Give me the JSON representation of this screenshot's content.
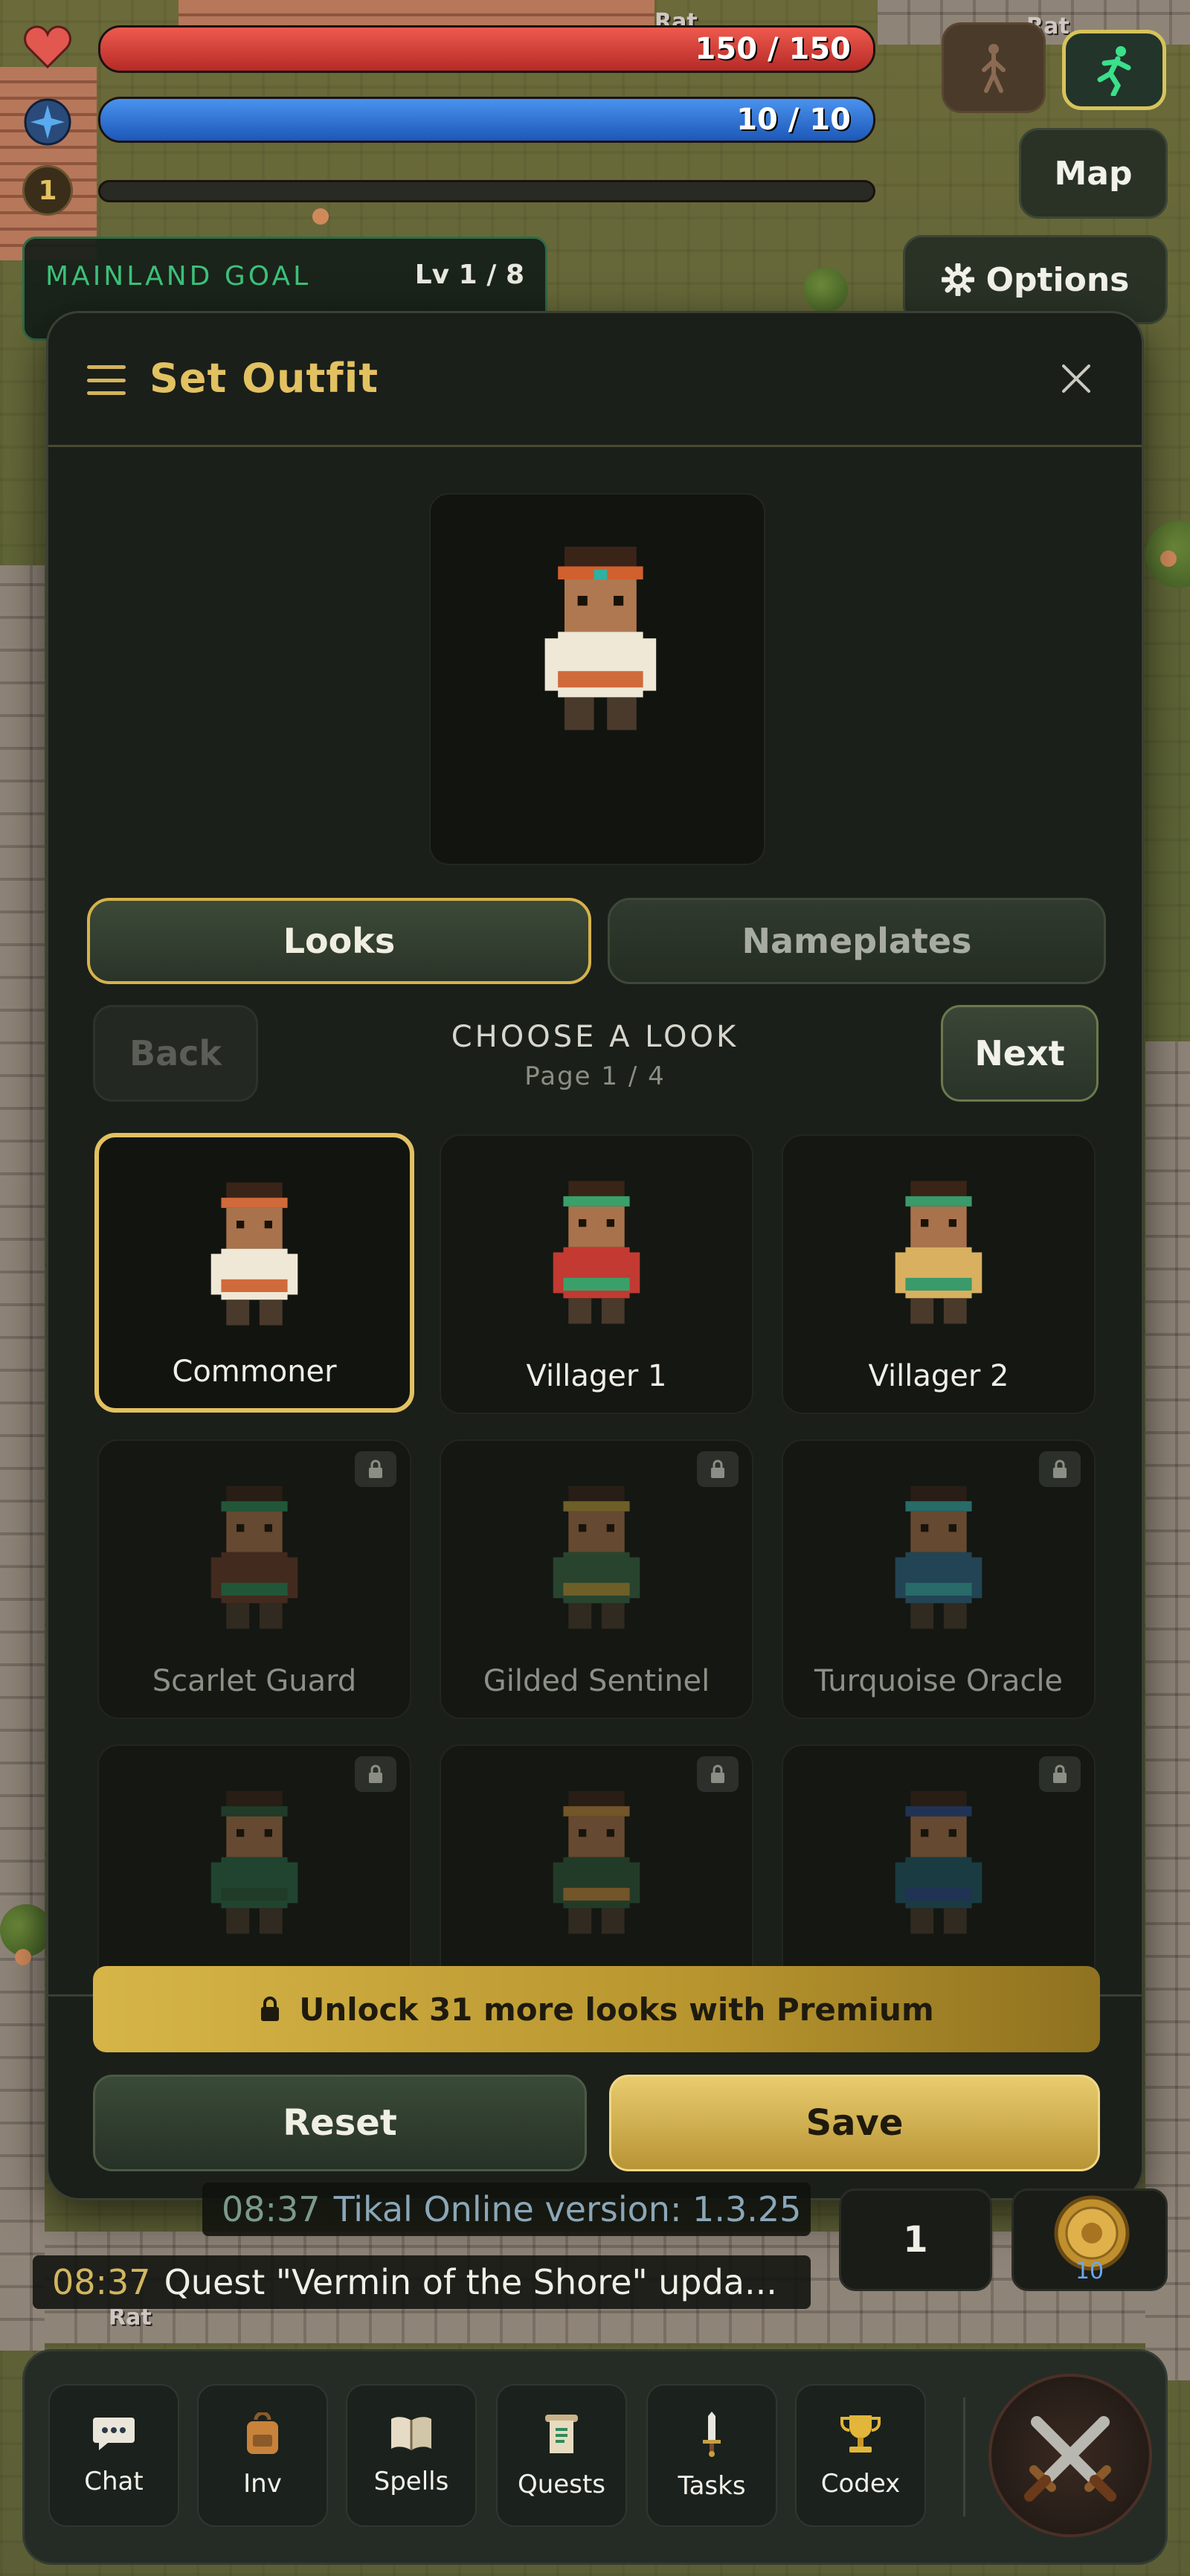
{
  "hud": {
    "health_text": "150 / 150",
    "health_fraction": 1.0,
    "mana_text": "10 / 10",
    "mana_fraction": 1.0,
    "level": "1",
    "xp_fraction": 0.0,
    "map_label": "Map",
    "options_label": "Options",
    "goal_label": "MAINLAND GOAL",
    "goal_level": "Lv 1 / 8",
    "colors": {
      "health": "#d43a3a",
      "mana": "#2f74d8",
      "accent_gold": "#e2c161"
    }
  },
  "world_labels": [
    "Rat",
    "Rat",
    "Rat"
  ],
  "modal": {
    "title": "Set Outfit",
    "tabs": [
      {
        "label": "Looks",
        "active": true
      },
      {
        "label": "Nameplates",
        "active": false
      }
    ],
    "back_label": "Back",
    "next_label": "Next",
    "choose_label": "CHOOSE A LOOK",
    "page_label": "Page 1 / 4",
    "looks": [
      {
        "name": "Commoner",
        "selected": true,
        "locked": false,
        "shirt": "#efe8d6",
        "accent": "#d06a3a"
      },
      {
        "name": "Villager 1",
        "selected": false,
        "locked": false,
        "shirt": "#c23a32",
        "accent": "#3aa06a"
      },
      {
        "name": "Villager 2",
        "selected": false,
        "locked": false,
        "shirt": "#d8b060",
        "accent": "#3a9a6a"
      },
      {
        "name": "Scarlet Guard",
        "selected": false,
        "locked": true,
        "shirt": "#6a3a28",
        "accent": "#2f8a5a"
      },
      {
        "name": "Gilded Sentinel",
        "selected": false,
        "locked": true,
        "shirt": "#3a6a48",
        "accent": "#b89a3a"
      },
      {
        "name": "Turquoise Oracle",
        "selected": false,
        "locked": true,
        "shirt": "#2f6a8a",
        "accent": "#3ab0b0"
      },
      {
        "name": "",
        "selected": false,
        "locked": true,
        "shirt": "#2a6a4a",
        "accent": "#2a5a3a"
      },
      {
        "name": "",
        "selected": false,
        "locked": true,
        "shirt": "#2f5a3a",
        "accent": "#c0883a"
      },
      {
        "name": "",
        "selected": false,
        "locked": true,
        "shirt": "#1f5a6a",
        "accent": "#2a4a8a"
      }
    ],
    "premium_label": "Unlock 31 more looks with Premium",
    "reset_label": "Reset",
    "save_label": "Save"
  },
  "chat": [
    {
      "time": "08:37",
      "text": "Tikal Online version: 1.3.25",
      "faded": true
    },
    {
      "time": "08:37",
      "text": "Quest \"Vermin of the Shore\" upda...",
      "faded": false
    }
  ],
  "slots": {
    "count_label": "1",
    "coin_count": "10"
  },
  "bottom_nav": [
    {
      "label": "Chat",
      "icon": "chat-icon"
    },
    {
      "label": "Inv",
      "icon": "backpack-icon"
    },
    {
      "label": "Spells",
      "icon": "spellbook-icon"
    },
    {
      "label": "Quests",
      "icon": "quest-scroll-icon"
    },
    {
      "label": "Tasks",
      "icon": "sword-icon"
    },
    {
      "label": "Codex",
      "icon": "trophy-icon"
    }
  ]
}
